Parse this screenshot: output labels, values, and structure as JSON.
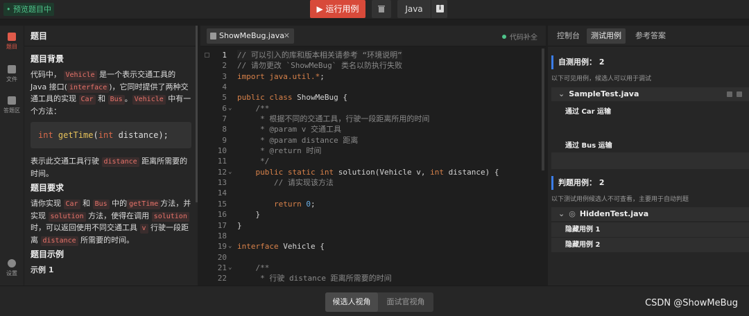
{
  "topbar": {
    "preview_badge": "• 预览题目中",
    "run_button": "▶ 运行用例",
    "language": "Java",
    "info_icon": "i"
  },
  "activity_bar": {
    "items": [
      {
        "label": "题目",
        "icon": "problem-icon"
      },
      {
        "label": "文件",
        "icon": "folder-icon"
      },
      {
        "label": "答题区",
        "icon": "answer-icon"
      },
      {
        "label": "设置",
        "icon": "gear-icon"
      }
    ]
  },
  "problem": {
    "header": "题目",
    "background_title": "题目背景",
    "p1_a": "代码中，",
    "chip_vehicle": "Vehicle",
    "p1_b": "是一个表示交通工具的 Java 接口(",
    "chip_interface": "interface",
    "p1_c": ")，它同时提供了两种交通工具的实现",
    "chip_car": "Car",
    "p1_d": "和",
    "chip_bus": "Bus",
    "p1_e": "。",
    "chip_vehicle2": "Vehicle",
    "p1_f": "中有一个方法：",
    "signature_kw1": "int",
    "signature_fn": "getTime",
    "signature_p": "(",
    "signature_kw2": "int",
    "signature_rest": " distance);",
    "p2_a": "表示此交通工具行驶",
    "chip_distance": "distance",
    "p2_b": "距离所需要的时间。",
    "requirement_title": "题目要求",
    "p3_a": "请你实现",
    "chip_car2": "Car",
    "p3_b": "和",
    "chip_bus2": "Bus",
    "p3_c": "中的",
    "chip_gettime": "getTime",
    "p3_d": "方法，并实现",
    "chip_solution": "solution",
    "p3_e": "方法，使得在调用",
    "chip_solution2": "solution",
    "p3_f": "时，可以返回使用不同交通工具",
    "chip_v": "v",
    "p3_g": "行驶一段距离",
    "chip_distance2": "distance",
    "p3_h": "所需要的时间。",
    "example_title": "题目示例",
    "example_sub": "示例 1"
  },
  "editor": {
    "tab_file": "ShowMeBug.java",
    "tab_close": "✕",
    "autocomplete": "代码补全",
    "lines": [
      {
        "n": "1",
        "fold": "",
        "html": "<span class='c-com'>// 可以引入的库和版本相关请参考 “环境说明”</span>",
        "current": true
      },
      {
        "n": "2",
        "fold": "",
        "html": "<span class='c-com'>// 请勿更改 `ShowMeBug` 类名以防执行失败</span>"
      },
      {
        "n": "3",
        "fold": "",
        "html": "<span class='c-kw'>import</span> <span class='c-type'>java.util.*</span>;"
      },
      {
        "n": "4",
        "fold": "",
        "html": ""
      },
      {
        "n": "5",
        "fold": "",
        "html": "<span class='c-kw'>public class</span> ShowMeBug {"
      },
      {
        "n": "6",
        "fold": "⌄",
        "html": "    <span class='c-com'>/**</span>"
      },
      {
        "n": "7",
        "fold": "",
        "html": "     <span class='c-com'>* 根据不同的交通工具，行驶一段距离所用的时间</span>"
      },
      {
        "n": "8",
        "fold": "",
        "html": "     <span class='c-com'>* @param v 交通工具</span>"
      },
      {
        "n": "9",
        "fold": "",
        "html": "     <span class='c-com'>* @param distance 距离</span>"
      },
      {
        "n": "10",
        "fold": "",
        "html": "     <span class='c-com'>* @return 时间</span>"
      },
      {
        "n": "11",
        "fold": "",
        "html": "     <span class='c-com'>*/</span>"
      },
      {
        "n": "12",
        "fold": "⌄",
        "html": "    <span class='c-kw'>public static int</span> solution(Vehicle v, <span class='c-kw'>int</span> distance) {"
      },
      {
        "n": "13",
        "fold": "",
        "html": "        <span class='c-com'>// 请实现该方法</span>"
      },
      {
        "n": "14",
        "fold": "",
        "html": ""
      },
      {
        "n": "15",
        "fold": "",
        "html": "        <span class='c-kw'>return</span> <span class='c-num'>0</span>;"
      },
      {
        "n": "16",
        "fold": "",
        "html": "    }"
      },
      {
        "n": "17",
        "fold": "",
        "html": "}"
      },
      {
        "n": "18",
        "fold": "",
        "html": ""
      },
      {
        "n": "19",
        "fold": "⌄",
        "html": "<span class='c-kw'>interface</span> Vehicle {"
      },
      {
        "n": "20",
        "fold": "",
        "html": ""
      },
      {
        "n": "21",
        "fold": "⌄",
        "html": "    <span class='c-com'>/**</span>"
      },
      {
        "n": "22",
        "fold": "",
        "html": "     <span class='c-com'>* 行驶 distance 距离所需要的时间</span>"
      }
    ]
  },
  "right_panel": {
    "tabs": [
      "控制台",
      "测试用例",
      "参考答案"
    ],
    "active_tab": 1,
    "self_test_title": "自测用例：  2",
    "self_test_sub": "以下可见用例，候选人可以用于调试",
    "self_test_file": "SampleTest.java",
    "self_cases": [
      "通过 Car 运输",
      "通过 Bus 运输"
    ],
    "judge_title": "判题用例：  2",
    "judge_sub": "以下测试用例候选人不可查看，主要用于自动判题",
    "judge_file": "HiddenTest.java",
    "judge_cases": [
      "隐藏用例 1",
      "隐藏用例 2"
    ]
  },
  "bottom": {
    "candidate_view": "候选人视角",
    "interviewer_view": "面试官视角",
    "watermark": "CSDN @ShowMeBug"
  },
  "colors": {
    "accent_red": "#d84a3a",
    "accent_blue": "#3b7de8",
    "success_green": "#4ec38a"
  }
}
